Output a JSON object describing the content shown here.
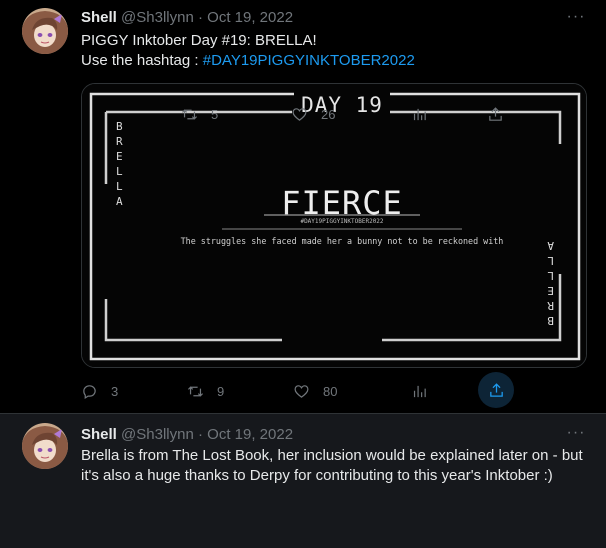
{
  "tweets": [
    {
      "author_name": "Shell",
      "author_handle": "@Sh3llynn",
      "separator": "·",
      "date": "Oct 19, 2022",
      "more_label": "···",
      "text_line1": "PIGGY Inktober Day #19: BRELLA!",
      "text_line2_prefix": "Use the hashtag : ",
      "hashtag": "#DAY19PIGGYINKTOBER2022",
      "media": {
        "day_label": "DAY 19",
        "side_text": "BRELLA",
        "title": "FIERCE",
        "hashtag": "#DAY19PIGGYINKTOBER2022",
        "caption": "The struggles she faced made her a bunny not to be reckoned with"
      },
      "replies": "3",
      "retweets": "9",
      "likes": "80"
    },
    {
      "author_name": "Shell",
      "author_handle": "@Sh3llynn",
      "separator": "·",
      "date": "Oct 19, 2022",
      "more_label": "···",
      "text": "Brella is from The Lost Book, her inclusion would be explained later on - but it's also a huge thanks to Derpy for contributing to this year's Inktober :)",
      "retweets": "5",
      "likes": "26"
    }
  ],
  "colors": {
    "background": "#000000",
    "reply_background": "#16181c",
    "link": "#1d9bf0",
    "muted": "#71767b",
    "text": "#e7e9ea"
  }
}
